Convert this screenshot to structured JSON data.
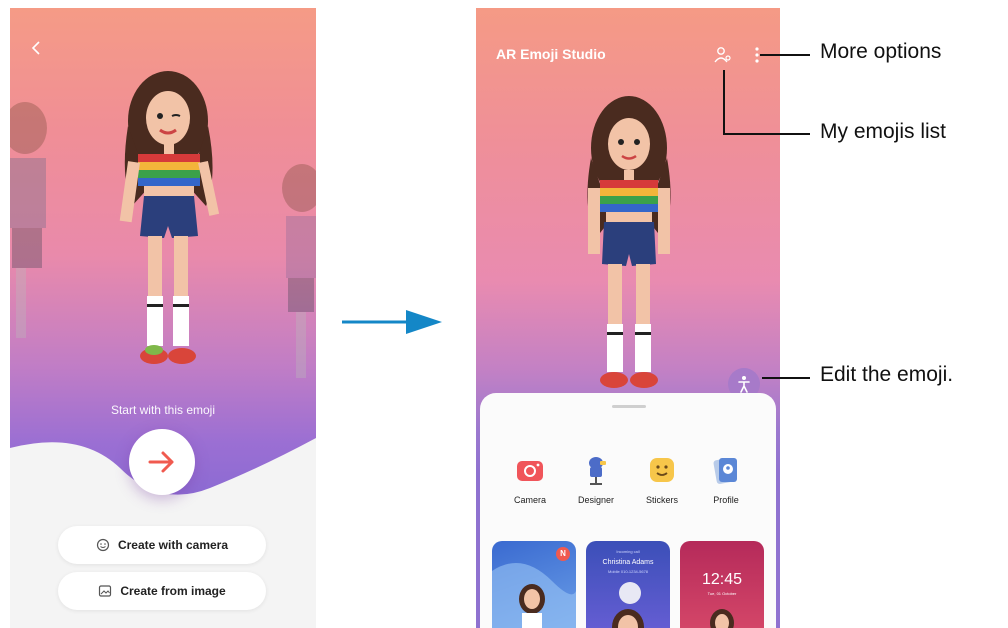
{
  "left_screen": {
    "start_label": "Start with this emoji",
    "buttons": {
      "create_camera": "Create with camera",
      "create_image": "Create from image"
    }
  },
  "right_screen": {
    "app_title": "AR Emoji Studio",
    "menu": [
      {
        "label": "Camera",
        "icon": "camera-icon",
        "color": "#f0555a"
      },
      {
        "label": "Designer",
        "icon": "designer-icon",
        "color": "#4c6cc8"
      },
      {
        "label": "Stickers",
        "icon": "stickers-icon",
        "color": "#f7c64a"
      },
      {
        "label": "Profile",
        "icon": "profile-icon",
        "color": "#5b87d6"
      }
    ],
    "cards": {
      "badge": "N",
      "profile_small": "Incoming call",
      "profile_name": "Christina Adams",
      "profile_sub": "Mobile 010-1234-5678",
      "lock_time": "12:45",
      "lock_date": "Tue, 01 October"
    }
  },
  "callouts": {
    "more_options": "More options",
    "my_emojis": "My emojis list",
    "edit_emoji": "Edit the emoji."
  },
  "colors": {
    "accent_arrow": "#1487c7",
    "fab_red": "#f05a4f"
  }
}
